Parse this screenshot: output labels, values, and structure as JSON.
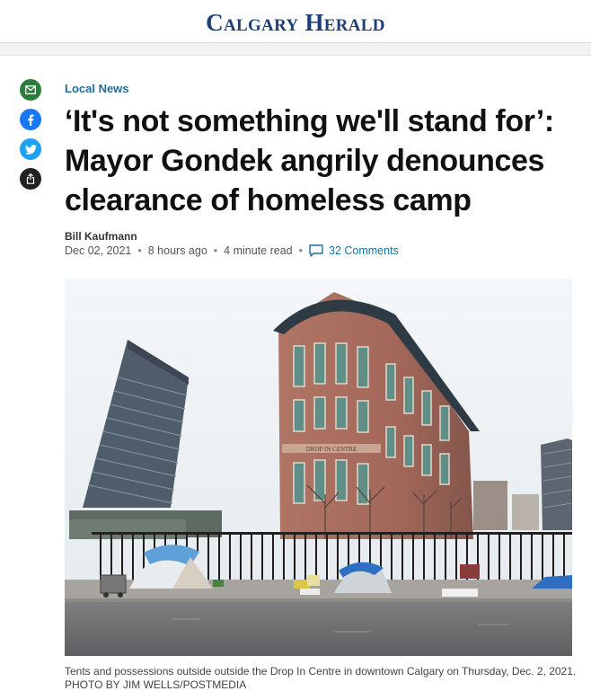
{
  "masthead": {
    "logo": "Calgary Herald"
  },
  "share": {
    "email_icon": "envelope-icon",
    "facebook_icon": "facebook-icon",
    "twitter_icon": "twitter-icon",
    "more_icon": "share-more-icon"
  },
  "article": {
    "category": "Local News",
    "headline": "‘It's not something we'll stand for’: Mayor Gondek angrily denounces clearance of homeless camp",
    "author": "Bill Kaufmann",
    "date": "Dec 02, 2021",
    "time_ago": "8 hours ago",
    "read_time": "4 minute read",
    "comments": "32 Comments",
    "separator": "•"
  },
  "photo": {
    "building_sign": "DROP IN CENTRE",
    "caption": "Tents and possessions outside outside the Drop In Centre in downtown Calgary on Thursday, Dec. 2, 2021. PHOTO BY JIM WELLS/POSTMEDIA"
  },
  "colors": {
    "brand": "#1f3f78",
    "link": "#1b6f9a",
    "email": "#2a7d3a",
    "facebook": "#1877f2",
    "twitter": "#1da1f2"
  }
}
